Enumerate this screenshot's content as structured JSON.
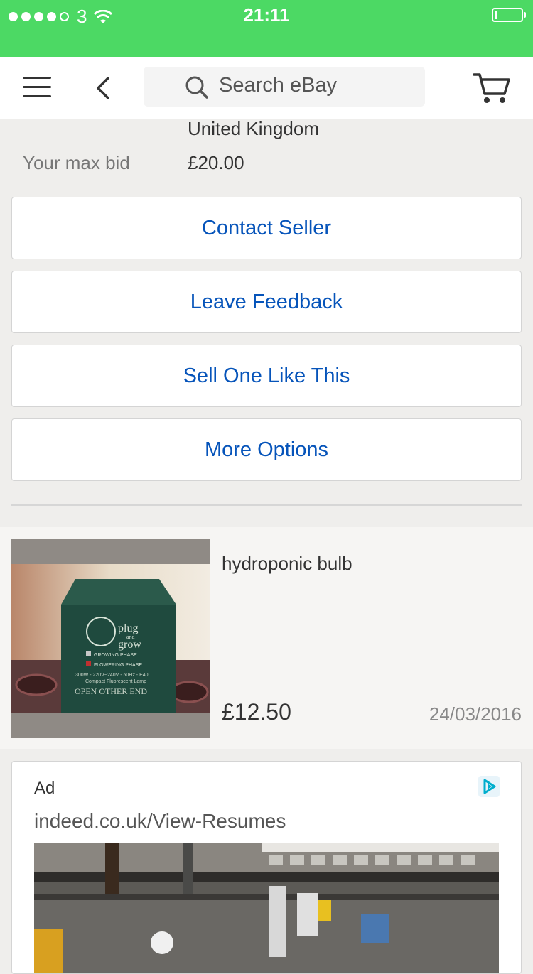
{
  "status_bar": {
    "carrier": "3",
    "time": "21:11",
    "signal_dots": [
      true,
      true,
      true,
      true,
      false
    ],
    "battery_level": 0.12
  },
  "header": {
    "search_placeholder": "Search eBay",
    "icons": [
      "menu-icon",
      "back-icon",
      "search-icon",
      "cart-icon"
    ]
  },
  "info": {
    "country": "United Kingdom",
    "max_bid_label": "Your max bid",
    "max_bid_value": "£20.00"
  },
  "actions": {
    "contact_seller": "Contact Seller",
    "leave_feedback": "Leave Feedback",
    "sell_one_like_this": "Sell One Like This",
    "more_options": "More Options"
  },
  "item": {
    "title": "hydroponic bulb",
    "price": "£12.50",
    "date": "24/03/2016",
    "image": {
      "brand_line1": "plug",
      "brand_line2": "and",
      "brand_line3": "grow",
      "growing": "GROWING PHASE",
      "flowering": "FLOWERING PHASE",
      "specs": "300W - 220V~240V - 50Hz - E40",
      "lamp": "Compact Fluorescent Lamp",
      "open": "OPEN OTHER END"
    }
  },
  "ad": {
    "label": "Ad",
    "url": "indeed.co.uk/View-Resumes"
  },
  "colors": {
    "status_bar": "#4cd964",
    "link_blue": "#0654ba",
    "background": "#efeeec"
  }
}
